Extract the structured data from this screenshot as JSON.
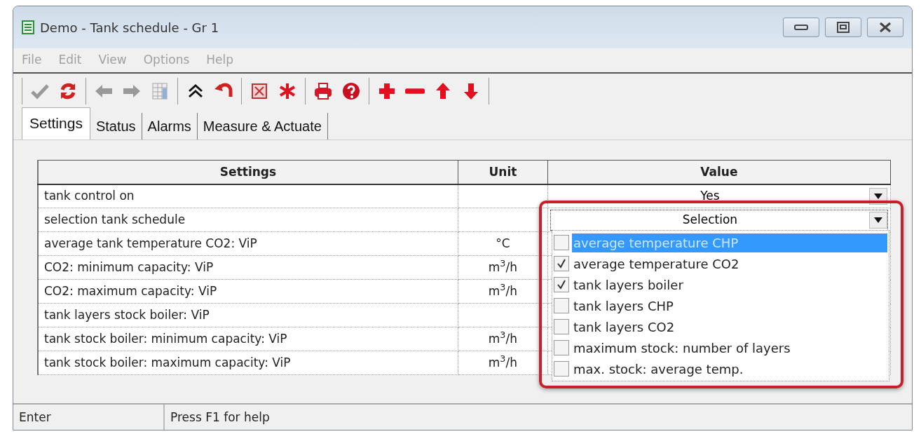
{
  "window": {
    "title": "Demo - Tank schedule - Gr 1"
  },
  "menu": [
    {
      "label": "File",
      "disabled": true
    },
    {
      "label": "Edit",
      "disabled": true
    },
    {
      "label": "View",
      "disabled": true
    },
    {
      "label": "Options",
      "disabled": true
    },
    {
      "label": "Help",
      "disabled": true
    }
  ],
  "toolbar": [
    [
      {
        "kind": "check",
        "disabled": true
      },
      {
        "kind": "refresh",
        "disabled": false
      }
    ],
    [
      {
        "kind": "left",
        "disabled": true
      },
      {
        "kind": "right",
        "disabled": true
      },
      {
        "kind": "grid",
        "disabled": true
      }
    ],
    [
      {
        "kind": "collapse",
        "disabled": false
      },
      {
        "kind": "undo",
        "disabled": false
      }
    ],
    [
      {
        "kind": "boxx",
        "disabled": false
      },
      {
        "kind": "asterisk",
        "disabled": false
      }
    ],
    [
      {
        "kind": "printer",
        "disabled": false
      },
      {
        "kind": "help",
        "disabled": false
      }
    ],
    [
      {
        "kind": "plus",
        "disabled": false
      },
      {
        "kind": "minus",
        "disabled": false
      },
      {
        "kind": "up",
        "disabled": false
      },
      {
        "kind": "down",
        "disabled": false
      }
    ]
  ],
  "tabs": [
    {
      "label": "Settings",
      "selected": true
    },
    {
      "label": "Status",
      "selected": false
    },
    {
      "label": "Alarms",
      "selected": false
    },
    {
      "label": "Measure & Actuate",
      "selected": false
    }
  ],
  "table": {
    "columns": [
      "Settings",
      "Unit",
      "Value"
    ],
    "rows": [
      {
        "setting": "tank control on",
        "value": "Yes"
      },
      {
        "setting": "selection tank schedule",
        "value": "Selection",
        "expanded": true
      },
      {
        "setting": "average tank temperature CO2: ViP",
        "unit": "°C"
      },
      {
        "setting": "CO2: minimum capacity: ViP",
        "unit": "m$^{3}$/h"
      },
      {
        "setting": "CO2: maximum capacity: ViP",
        "unit": "m$^{3}$/h"
      },
      {
        "setting": "tank layers stock boiler: ViP"
      },
      {
        "setting": "tank stock boiler: minimum capacity: ViP",
        "unit": "m$^{3}$/h"
      },
      {
        "setting": "tank stock boiler: maximum capacity: ViP",
        "unit": "m$^{3}$/h"
      }
    ]
  },
  "dropdown_options": [
    {
      "label": "average temperature CHP",
      "checked": false,
      "selected": true
    },
    {
      "label": "average temperature CO2",
      "checked": true,
      "selected": false
    },
    {
      "label": "tank layers boiler",
      "checked": true,
      "selected": false
    },
    {
      "label": "tank layers CHP",
      "checked": false,
      "selected": false
    },
    {
      "label": "tank layers CO2",
      "checked": false,
      "selected": false
    },
    {
      "label": "maximum stock: number of layers",
      "checked": false,
      "selected": false
    },
    {
      "label": "max. stock: average temp.",
      "checked": false,
      "selected": false
    }
  ],
  "status_bar": [
    "Enter",
    "Press F1 for help"
  ]
}
